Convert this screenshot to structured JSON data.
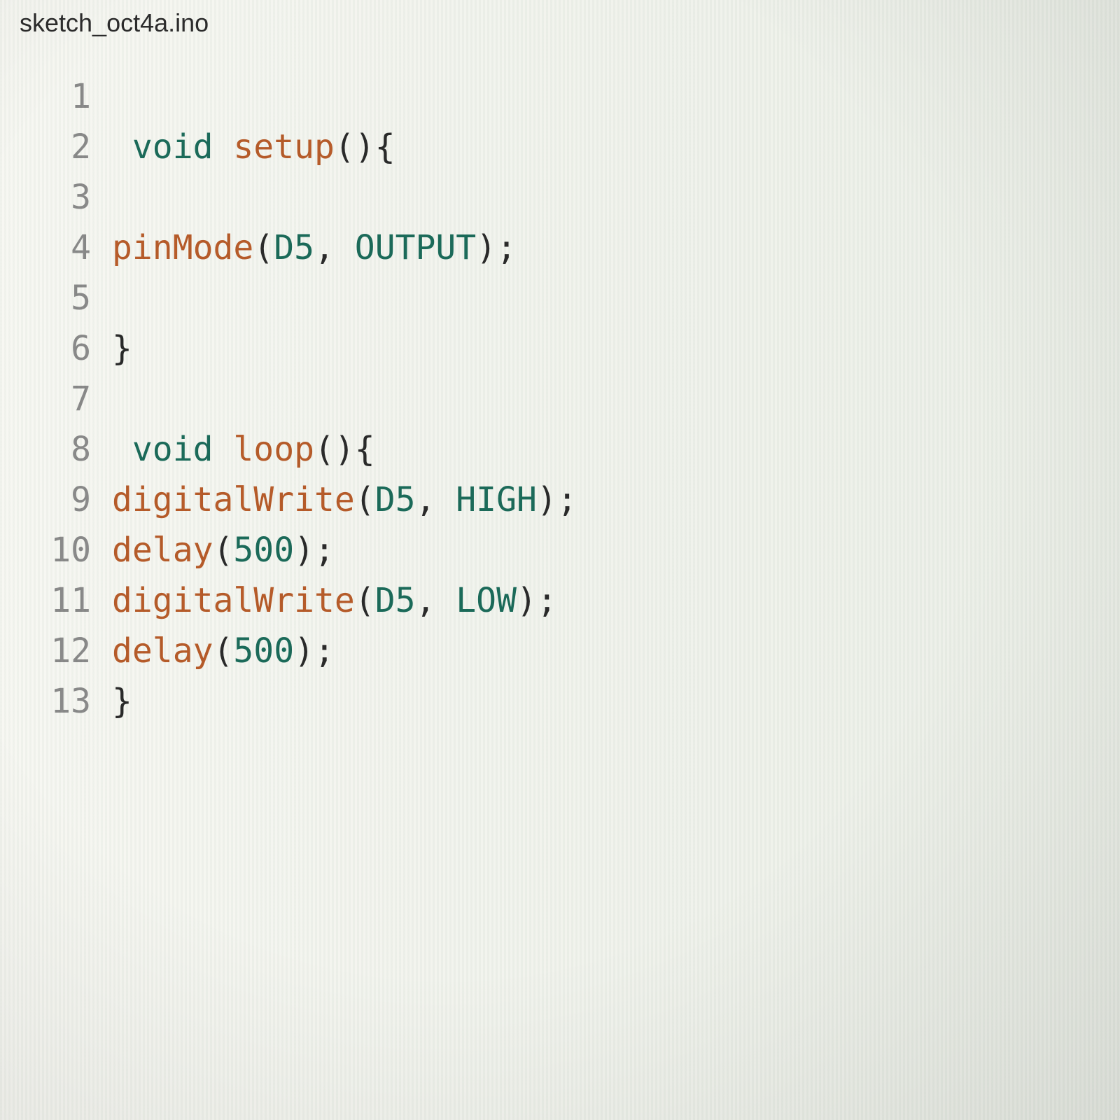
{
  "tab": {
    "title": "sketch_oct4a.ino"
  },
  "code": {
    "lines": [
      {
        "n": "1",
        "tokens": []
      },
      {
        "n": "2",
        "tokens": [
          {
            "cls": "pn",
            "t": " "
          },
          {
            "cls": "kw",
            "t": "void"
          },
          {
            "cls": "pn",
            "t": " "
          },
          {
            "cls": "fn",
            "t": "setup"
          },
          {
            "cls": "pn",
            "t": "(){"
          }
        ]
      },
      {
        "n": "3",
        "tokens": []
      },
      {
        "n": "4",
        "tokens": [
          {
            "cls": "fn",
            "t": "pinMode"
          },
          {
            "cls": "pn",
            "t": "("
          },
          {
            "cls": "id",
            "t": "D5"
          },
          {
            "cls": "pn",
            "t": ", "
          },
          {
            "cls": "id",
            "t": "OUTPUT"
          },
          {
            "cls": "pn",
            "t": ");"
          }
        ]
      },
      {
        "n": "5",
        "tokens": []
      },
      {
        "n": "6",
        "tokens": [
          {
            "cls": "pn",
            "t": "}"
          }
        ]
      },
      {
        "n": "7",
        "tokens": []
      },
      {
        "n": "8",
        "tokens": [
          {
            "cls": "pn",
            "t": " "
          },
          {
            "cls": "kw",
            "t": "void"
          },
          {
            "cls": "pn",
            "t": " "
          },
          {
            "cls": "fn",
            "t": "loop"
          },
          {
            "cls": "pn",
            "t": "(){"
          }
        ]
      },
      {
        "n": "9",
        "tokens": [
          {
            "cls": "fn",
            "t": "digitalWrite"
          },
          {
            "cls": "pn",
            "t": "("
          },
          {
            "cls": "id",
            "t": "D5"
          },
          {
            "cls": "pn",
            "t": ", "
          },
          {
            "cls": "id",
            "t": "HIGH"
          },
          {
            "cls": "pn",
            "t": ");"
          }
        ]
      },
      {
        "n": "10",
        "tokens": [
          {
            "cls": "fn",
            "t": "delay"
          },
          {
            "cls": "pn",
            "t": "("
          },
          {
            "cls": "num",
            "t": "500"
          },
          {
            "cls": "pn",
            "t": ");"
          }
        ]
      },
      {
        "n": "11",
        "tokens": [
          {
            "cls": "fn",
            "t": "digitalWrite"
          },
          {
            "cls": "pn",
            "t": "("
          },
          {
            "cls": "id",
            "t": "D5"
          },
          {
            "cls": "pn",
            "t": ", "
          },
          {
            "cls": "id",
            "t": "LOW"
          },
          {
            "cls": "pn",
            "t": ");"
          }
        ]
      },
      {
        "n": "12",
        "tokens": [
          {
            "cls": "fn",
            "t": "delay"
          },
          {
            "cls": "pn",
            "t": "("
          },
          {
            "cls": "num",
            "t": "500"
          },
          {
            "cls": "pn",
            "t": ");"
          }
        ]
      },
      {
        "n": "13",
        "tokens": [
          {
            "cls": "pn",
            "t": "}"
          }
        ]
      }
    ]
  }
}
